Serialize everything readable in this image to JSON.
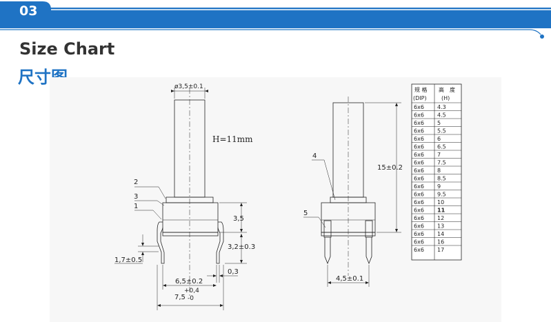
{
  "section": {
    "number": "03",
    "title_en": "Size Chart",
    "title_zh": "尺寸图"
  },
  "colors": {
    "brand_blue": "#1f73c4",
    "highlight_red": "#e0241c"
  },
  "left_view": {
    "diameter_label": "ø3,5±0.1",
    "height_note": "H=11mm",
    "callouts": [
      "2",
      "3",
      "1"
    ],
    "dim_body_height": "3,5",
    "dim_pin_length": "3,2±0.3",
    "dim_pin_thickness": "0,3",
    "dim_offset": "1,7±0.5",
    "dim_pin_pitch": "6,5±0.2",
    "dim_width_main": "7,5",
    "dim_width_tol_plus": "+0,4",
    "dim_width_tol_minus": "-0"
  },
  "right_view": {
    "callouts": [
      "4",
      "5"
    ],
    "dim_total_height": "15±0.2",
    "dim_pin_span": "4,5±0.1"
  },
  "size_table": {
    "header_spec": "规 格",
    "header_spec_sub": "(DIP)",
    "header_height": "高　度",
    "header_height_sub": "(H)",
    "highlight_index": 14,
    "rows": [
      {
        "spec": "6x6",
        "height": "4.3"
      },
      {
        "spec": "6x6",
        "height": "4.5"
      },
      {
        "spec": "6x6",
        "height": "5"
      },
      {
        "spec": "6x6",
        "height": "5.5"
      },
      {
        "spec": "6x6",
        "height": "6"
      },
      {
        "spec": "6x6",
        "height": "6.5"
      },
      {
        "spec": "6x6",
        "height": "7"
      },
      {
        "spec": "6x6",
        "height": "7.5"
      },
      {
        "spec": "6x6",
        "height": "8"
      },
      {
        "spec": "6x6",
        "height": "8.5"
      },
      {
        "spec": "6x6",
        "height": "9"
      },
      {
        "spec": "6x6",
        "height": "9.5"
      },
      {
        "spec": "6x6",
        "height": "10"
      },
      {
        "spec": "6x6",
        "height": "11"
      },
      {
        "spec": "6x6",
        "height": "12"
      },
      {
        "spec": "6x6",
        "height": "13"
      },
      {
        "spec": "6x6",
        "height": "14"
      },
      {
        "spec": "6x6",
        "height": "16"
      },
      {
        "spec": "6x6",
        "height": "17"
      }
    ]
  }
}
